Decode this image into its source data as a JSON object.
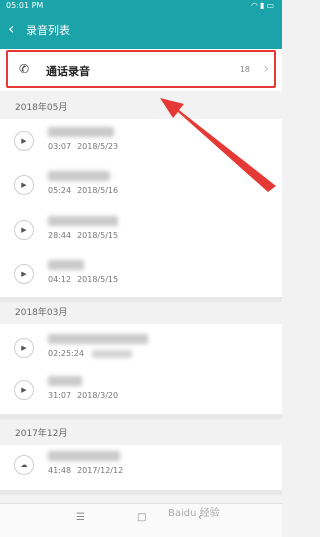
{
  "status": {
    "time": "05:01 PM",
    "icons": "wifi-icon signal-icon battery-icon"
  },
  "app_bar": {
    "title": "录音列表"
  },
  "call_records": {
    "label": "通话录音",
    "count": "18"
  },
  "sections": [
    {
      "header": "2018年05月",
      "items": [
        {
          "duration": "03:07",
          "date": "2018/5/23"
        },
        {
          "duration": "05:24",
          "date": "2018/5/16"
        },
        {
          "duration": "28:44",
          "date": "2018/5/15"
        },
        {
          "duration": "04:12",
          "date": "2018/5/15"
        }
      ]
    },
    {
      "header": "2018年03月",
      "items": [
        {
          "duration": "02:25:24",
          "date": ""
        },
        {
          "duration": "31:07",
          "date": "2018/3/20"
        }
      ]
    },
    {
      "header": "2017年12月",
      "items": [
        {
          "duration": "41:48",
          "date": "2017/12/12"
        }
      ]
    }
  ],
  "watermark": "Baidu 经验",
  "colors": {
    "accent": "#1aa3a8",
    "highlight": "#e53935"
  }
}
